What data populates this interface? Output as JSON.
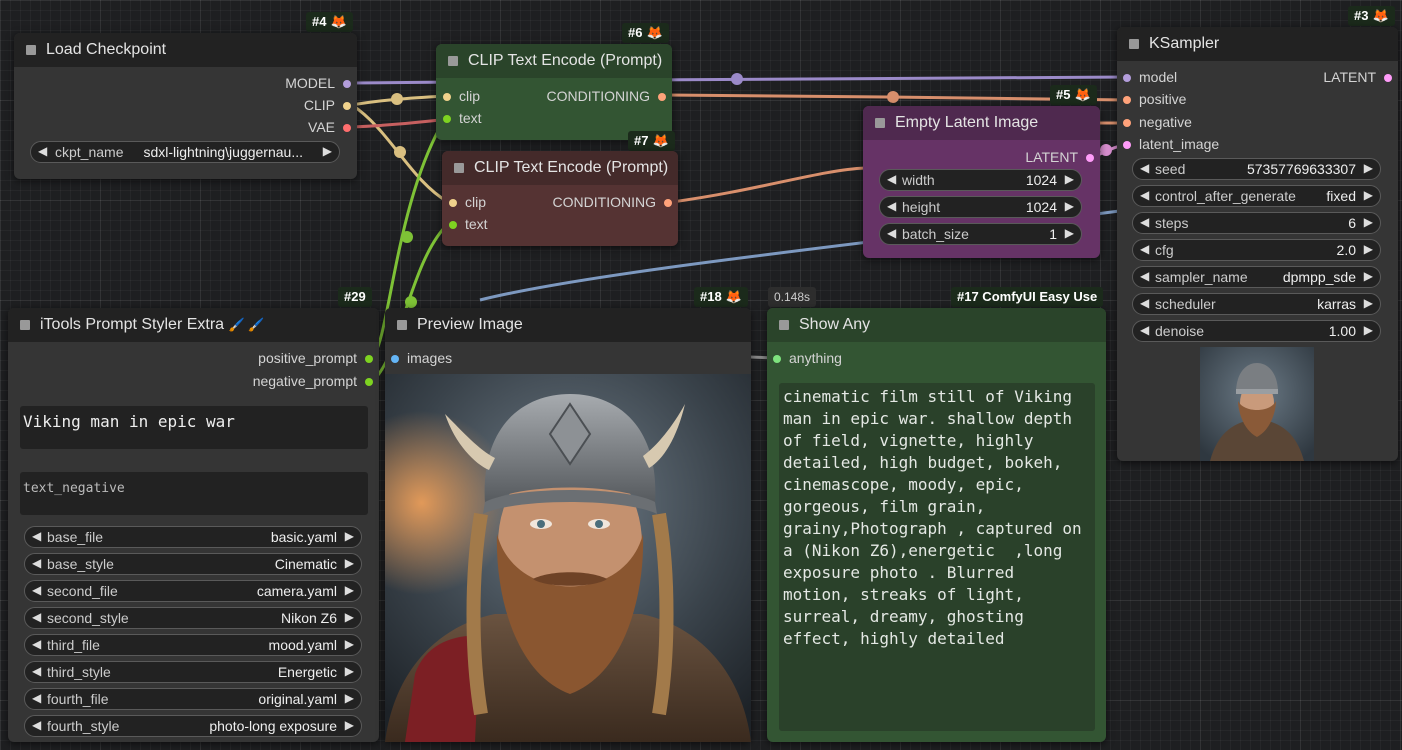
{
  "nodes": {
    "load_checkpoint": {
      "badge": "#4",
      "title": "Load Checkpoint",
      "outputs": [
        "MODEL",
        "CLIP",
        "VAE"
      ],
      "widgets": [
        {
          "label": "ckpt_name",
          "value": "sdxl-lightning\\juggernau..."
        }
      ]
    },
    "clip_encode_pos": {
      "badge": "#6",
      "title": "CLIP Text Encode (Prompt)",
      "inputs": [
        "clip",
        "text"
      ],
      "outputs": [
        "CONDITIONING"
      ]
    },
    "clip_encode_neg": {
      "badge": "#7",
      "title": "CLIP Text Encode (Prompt)",
      "inputs": [
        "clip",
        "text"
      ],
      "outputs": [
        "CONDITIONING"
      ]
    },
    "empty_latent": {
      "badge": "#5",
      "title": "Empty Latent Image",
      "outputs": [
        "LATENT"
      ],
      "widgets": [
        {
          "label": "width",
          "value": "1024"
        },
        {
          "label": "height",
          "value": "1024"
        },
        {
          "label": "batch_size",
          "value": "1"
        }
      ]
    },
    "ksampler": {
      "badge": "#3",
      "title": "KSampler",
      "inputs": [
        "model",
        "positive",
        "negative",
        "latent_image"
      ],
      "outputs": [
        "LATENT"
      ],
      "widgets": [
        {
          "label": "seed",
          "value": "57357769633307"
        },
        {
          "label": "control_after_generate",
          "value": "fixed"
        },
        {
          "label": "steps",
          "value": "6"
        },
        {
          "label": "cfg",
          "value": "2.0"
        },
        {
          "label": "sampler_name",
          "value": "dpmpp_sde"
        },
        {
          "label": "scheduler",
          "value": "karras"
        },
        {
          "label": "denoise",
          "value": "1.00"
        }
      ]
    },
    "prompt_styler": {
      "badge": "#29",
      "title": "iTools Prompt Styler Extra",
      "title_icons": "🖌️ 🖌️",
      "outputs": [
        "positive_prompt",
        "negative_prompt"
      ],
      "text_positive": "Viking man in epic war",
      "text_negative": "text_negative",
      "widgets": [
        {
          "label": "base_file",
          "value": "basic.yaml"
        },
        {
          "label": "base_style",
          "value": "Cinematic"
        },
        {
          "label": "second_file",
          "value": "camera.yaml"
        },
        {
          "label": "second_style",
          "value": "Nikon Z6"
        },
        {
          "label": "third_file",
          "value": "mood.yaml"
        },
        {
          "label": "third_style",
          "value": "Energetic"
        },
        {
          "label": "fourth_file",
          "value": "original.yaml"
        },
        {
          "label": "fourth_style",
          "value": "photo-long exposure"
        }
      ]
    },
    "preview_image": {
      "badge": "#18",
      "title": "Preview Image",
      "inputs": [
        "images"
      ]
    },
    "show_any": {
      "timer": "0.148s",
      "badge": "#17 ComfyUI Easy Use",
      "title": "Show Any",
      "inputs": [
        "anything"
      ],
      "text": "cinematic film still of Viking man in epic war. shallow depth of field, vignette, highly detailed, high budget, bokeh, cinemascope, moody, epic, gorgeous, film grain, grainy,Photograph , captured on a (Nikon Z6),energetic  ,long exposure photo . Blurred motion, streaks of light, surreal, dreamy, ghosting effect, highly detailed"
    }
  },
  "colors": {
    "model": "#b39ddb",
    "clip": "#f0d28c",
    "vae": "#ff6e6e",
    "conditioning": "#ffa27a",
    "latent": "#ff9cf9",
    "image": "#64b5f6",
    "text": "#7ed321",
    "positive_node_bg": "#335533",
    "negative_node_bg": "#553333",
    "latent_node_bg": "#663366"
  }
}
